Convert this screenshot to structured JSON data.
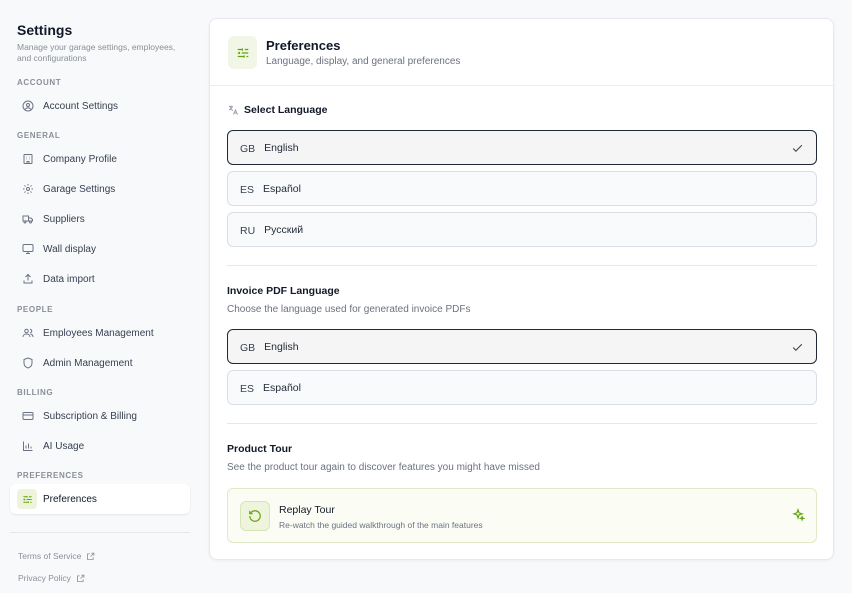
{
  "sidebar": {
    "title": "Settings",
    "subtitle": "Manage your garage settings, employees, and configurations",
    "sections": {
      "account": "ACCOUNT",
      "general": "GENERAL",
      "people": "PEOPLE",
      "billing": "BILLING",
      "preferences": "PREFERENCES"
    },
    "items": {
      "account_settings": "Account Settings",
      "company_profile": "Company Profile",
      "garage_settings": "Garage Settings",
      "suppliers": "Suppliers",
      "wall_display": "Wall display",
      "data_import": "Data import",
      "employees_management": "Employees Management",
      "admin_management": "Admin Management",
      "subscription_billing": "Subscription & Billing",
      "ai_usage": "AI Usage",
      "preferences": "Preferences"
    },
    "active_item": "preferences",
    "links": {
      "terms": "Terms of Service",
      "privacy": "Privacy Policy"
    }
  },
  "header": {
    "title": "Preferences",
    "subtitle": "Language, display, and general preferences"
  },
  "language": {
    "label": "Select Language",
    "options": [
      {
        "code": "GB",
        "name": "English",
        "selected": true
      },
      {
        "code": "ES",
        "name": "Español",
        "selected": false
      },
      {
        "code": "RU",
        "name": "Русский",
        "selected": false
      }
    ]
  },
  "invoice_language": {
    "label": "Invoice PDF Language",
    "description": "Choose the language used for generated invoice PDFs",
    "options": [
      {
        "code": "GB",
        "name": "English",
        "selected": true
      },
      {
        "code": "ES",
        "name": "Español",
        "selected": false
      }
    ]
  },
  "product_tour": {
    "label": "Product Tour",
    "description": "See the product tour again to discover features you might have missed",
    "button_title": "Replay Tour",
    "button_subtitle": "Re-watch the guided walkthrough of the main features"
  },
  "colors": {
    "accent": "#65a30d",
    "accent_bg": "#eef4dc",
    "selected_border": "#1f2937"
  }
}
